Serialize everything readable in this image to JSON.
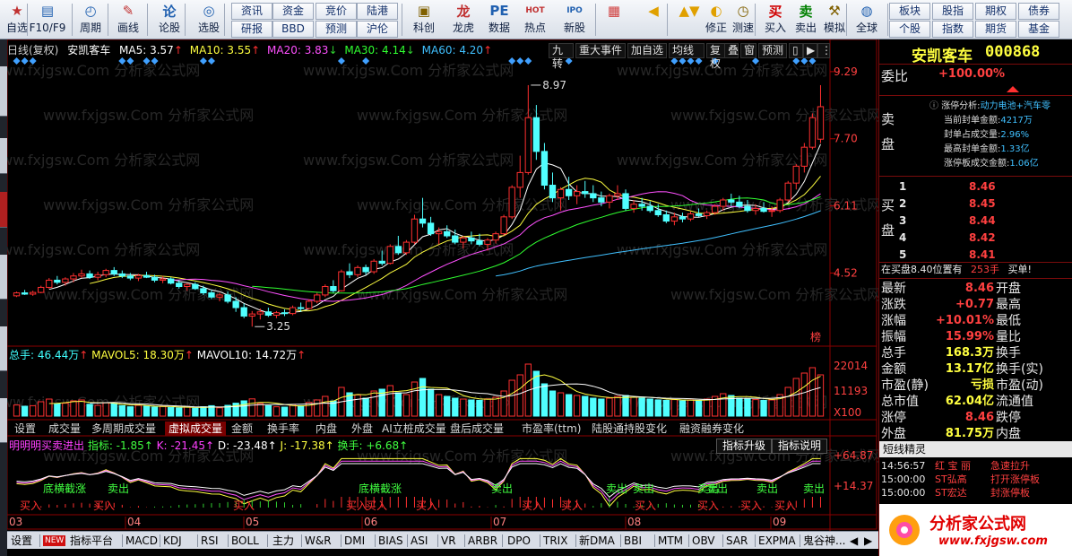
{
  "toolbar": {
    "items": [
      {
        "label": "自选",
        "icon": "star-icon",
        "ic": "★",
        "color": "#c03030"
      },
      {
        "label": "F10/F9",
        "icon": "file-icon",
        "ic": "▤",
        "color": "#2060b0"
      },
      {
        "label": "周期",
        "icon": "clock-icon",
        "ic": "◴",
        "color": "#2060b0"
      },
      {
        "label": "画线",
        "icon": "pen-icon",
        "ic": "✎",
        "color": "#c03030"
      },
      {
        "label": "论股",
        "icon": "forum-icon",
        "ic": "论",
        "color": "#2060b0"
      },
      {
        "label": "选股",
        "icon": "select-icon",
        "ic": "◎",
        "color": "#2060b0"
      },
      {
        "label": "科创",
        "icon": "kechuang-icon",
        "ic": "▣",
        "color": "#806000"
      },
      {
        "label": "龙虎",
        "icon": "dragon-icon",
        "ic": "龙",
        "color": "#c03030"
      },
      {
        "label": "数据",
        "icon": "data-icon",
        "ic": "PE",
        "color": "#2060b0"
      },
      {
        "label": "热点",
        "icon": "hot-icon",
        "ic": "HOT",
        "color": "#c03030"
      },
      {
        "label": "新股",
        "icon": "ipo-icon",
        "ic": "IPO",
        "color": "#2060b0"
      },
      {
        "label": "",
        "icon": "windows-icon",
        "ic": "▦",
        "color": "#d04040"
      },
      {
        "label": "",
        "icon": "back-arrow-icon",
        "ic": "◀",
        "color": "#e0a000"
      },
      {
        "label": "",
        "icon": "updown-arrow-icon",
        "ic": "▲▼",
        "color": "#e0a000"
      },
      {
        "label": "修正",
        "icon": "fix-icon",
        "ic": "◐",
        "color": "#e0a000"
      },
      {
        "label": "测速",
        "icon": "speed-icon",
        "ic": "◷",
        "color": "#806000"
      },
      {
        "label": "买入",
        "icon": "buy-icon",
        "ic": "买",
        "color": "#d00000"
      },
      {
        "label": "卖出",
        "icon": "sell-icon",
        "ic": "卖",
        "color": "#008000"
      },
      {
        "label": "模拟",
        "icon": "hammer-icon",
        "ic": "⚒",
        "color": "#806000"
      },
      {
        "label": "全球",
        "icon": "globe-icon",
        "ic": "◍",
        "color": "#2060b0"
      }
    ],
    "small": [
      "资讯",
      "资金",
      "竞价",
      "陆港",
      "研报",
      "BBD",
      "预测",
      "沪伦",
      "板块",
      "股指",
      "期权",
      "债券",
      "个股",
      "指数",
      "期货",
      "基金"
    ]
  },
  "header": {
    "period": "日线(复权)",
    "name": "安凯客车",
    "ma5": "MA5: 3.57",
    "ma10": "MA10: 3.55",
    "ma20": "MA20: 3.83",
    "ma30": "MA30: 4.14",
    "ma60": "MA60: 4.20"
  },
  "menu": [
    "九转",
    "重大事件",
    "加自选",
    "均线",
    "复权",
    "叠",
    "窗",
    "预测"
  ],
  "price_axis": [
    "9.29",
    "7.70",
    "6.11",
    "4.52"
  ],
  "annotations": {
    "high": "8.97",
    "low": "3.25",
    "bang": "榜"
  },
  "vol": {
    "title": "总手: 46.44万",
    "mavol5": "MAVOL5: 18.30万",
    "mavol10": "MAVOL10: 14.72万",
    "ticks": [
      "22014",
      "11193",
      "X100"
    ]
  },
  "vol_tabs": [
    "设置",
    "成交量",
    "多周期成交量",
    "虚拟成交量",
    "金额",
    "换手率",
    "内盘",
    "外盘",
    "AI立桩成交量",
    "盘后成交量",
    "市盈率(ttm)",
    "陆股通持股变化",
    "融资融券变化"
  ],
  "ind": {
    "name": "明明明买卖进出",
    "zb": "指标: -1.85",
    "k": "K: -21.45",
    "d": "D: -23.48",
    "j": "J: -17.38",
    "hs": "换手: +6.68",
    "btn1": "指标升级",
    "btn2": "指标说明",
    "ticks": [
      "+64.87",
      "+14.37"
    ],
    "sig_top": [
      "底横截涨",
      "卖出",
      "底横截涨",
      "卖出",
      "卖出",
      "卖出",
      "卖出",
      "卖出",
      "卖出",
      "卖出"
    ],
    "sig_bot": [
      "买入",
      "买入",
      "买入",
      "买入",
      "买入",
      "买入",
      "买入",
      "买入",
      "买入",
      "买入",
      "买入",
      "买入"
    ]
  },
  "months": [
    "03",
    "04",
    "05",
    "06",
    "07",
    "08",
    "09"
  ],
  "bottom": [
    "设置",
    "NEW",
    "指标平台",
    "MACD",
    "KDJ",
    "RSI",
    "BOLL",
    "主力",
    "W&R",
    "DMI",
    "BIAS",
    "ASI",
    "VR",
    "ARBR",
    "DPO",
    "TRIX",
    "新DMA",
    "BBI",
    "MTM",
    "OBV",
    "SAR",
    "EXPMA",
    "鬼谷神..."
  ],
  "stock": {
    "name": "安凯客车",
    "code": "000868"
  },
  "weibi": {
    "label": "委比",
    "value": "+100.00%"
  },
  "zt": {
    "l1": "涨停分析:",
    "l1v": "动力电池+汽车零",
    "l2": "当前封单金额:",
    "l2v": "4217万",
    "l3": "封单占成交量:",
    "l3v": "2.96%",
    "l4": "最高封单金额:",
    "l4v": "1.33亿",
    "l5": "涨停板成交金额:",
    "l5v": "1.06亿"
  },
  "sell_label": "卖盘",
  "buy_label": "买盘",
  "bids": [
    {
      "n": "1",
      "p": "8.46"
    },
    {
      "n": "2",
      "p": "8.45"
    },
    {
      "n": "3",
      "p": "8.44"
    },
    {
      "n": "4",
      "p": "8.42"
    },
    {
      "n": "5",
      "p": "8.41"
    }
  ],
  "bidline": {
    "t1": "在买盘8.40位置有",
    "v": "253手",
    "t2": "买单!"
  },
  "quotes": [
    {
      "l": "最新",
      "v": "8.46",
      "l2": "开盘",
      "v2": ""
    },
    {
      "l": "涨跌",
      "v": "+0.77",
      "l2": "最高",
      "v2": ""
    },
    {
      "l": "涨幅",
      "v": "+10.01%",
      "l2": "最低",
      "v2": ""
    },
    {
      "l": "振幅",
      "v": "15.99%",
      "l2": "量比",
      "v2": ""
    },
    {
      "l": "总手",
      "v": "168.3万",
      "l2": "换手",
      "v2": ""
    },
    {
      "l": "金额",
      "v": "13.17亿",
      "l2": "换手(实)",
      "v2": ""
    },
    {
      "l": "市盈(静)",
      "v": "亏损",
      "l2": "市盈(动)",
      "v2": ""
    },
    {
      "l": "总市值",
      "v": "62.04亿",
      "l2": "流通值",
      "v2": ""
    },
    {
      "l": "涨停",
      "v": "8.46",
      "l2": "跌停",
      "v2": ""
    },
    {
      "l": "外盘",
      "v": "81.75万",
      "l2": "内盘",
      "v2": ""
    }
  ],
  "short_title": "短线精灵",
  "news": [
    {
      "t": "14:56:57",
      "s": "红 宝 丽",
      "e": "急速拉升"
    },
    {
      "t": "15:00:00",
      "s": "ST弘高",
      "e": "打开涨停板"
    },
    {
      "t": "15:00:00",
      "s": "ST宏达",
      "e": "封涨停板"
    }
  ],
  "watermark": {
    "line": "www.fxjgsw.Com 分析家公式网",
    "logo": "分析家公式网",
    "url": "www.fxjgsw.com"
  },
  "chart_data": {
    "type": "candlestick",
    "series": [
      {
        "name": "K线",
        "ohlc": [
          [
            3.98,
            4.08,
            3.95,
            4.05
          ],
          [
            4.05,
            4.12,
            4.0,
            4.02
          ],
          [
            4.02,
            4.1,
            3.98,
            4.06
          ],
          [
            4.06,
            4.22,
            4.04,
            4.18
          ],
          [
            4.18,
            4.4,
            4.15,
            4.35
          ],
          [
            4.35,
            4.45,
            4.25,
            4.3
          ],
          [
            4.3,
            4.42,
            4.22,
            4.38
          ],
          [
            4.38,
            4.52,
            4.3,
            4.45
          ],
          [
            4.45,
            4.6,
            4.4,
            4.5
          ],
          [
            4.5,
            4.58,
            4.38,
            4.42
          ],
          [
            4.42,
            4.55,
            4.35,
            4.48
          ],
          [
            4.48,
            4.62,
            4.42,
            4.58
          ],
          [
            4.58,
            4.66,
            4.45,
            4.5
          ],
          [
            4.5,
            4.58,
            4.4,
            4.45
          ],
          [
            4.45,
            4.52,
            4.35,
            4.4
          ],
          [
            4.4,
            4.5,
            4.33,
            4.46
          ],
          [
            4.46,
            4.55,
            4.4,
            4.42
          ],
          [
            4.42,
            4.48,
            4.3,
            4.35
          ],
          [
            4.35,
            4.45,
            4.28,
            4.38
          ],
          [
            4.38,
            4.42,
            4.25,
            4.28
          ],
          [
            4.28,
            4.35,
            4.15,
            4.2
          ],
          [
            4.2,
            4.28,
            4.1,
            4.25
          ],
          [
            4.25,
            4.3,
            4.12,
            4.15
          ],
          [
            4.15,
            4.22,
            4.0,
            4.05
          ],
          [
            4.05,
            4.12,
            3.9,
            3.95
          ],
          [
            3.95,
            4.05,
            3.85,
            4.0
          ],
          [
            4.0,
            4.08,
            3.8,
            3.85
          ],
          [
            3.85,
            3.95,
            3.6,
            3.7
          ],
          [
            3.7,
            3.8,
            3.45,
            3.5
          ],
          [
            3.5,
            3.62,
            3.25,
            3.55
          ],
          [
            3.55,
            3.68,
            3.42,
            3.6
          ],
          [
            3.6,
            3.7,
            3.48,
            3.52
          ],
          [
            3.52,
            3.62,
            3.45,
            3.58
          ],
          [
            3.58,
            3.66,
            3.5,
            3.56
          ],
          [
            3.56,
            3.75,
            3.52,
            3.7
          ],
          [
            3.7,
            3.82,
            3.6,
            3.68
          ],
          [
            3.68,
            3.9,
            3.65,
            3.85
          ],
          [
            3.85,
            4.05,
            3.8,
            4.0
          ],
          [
            4.0,
            4.25,
            3.95,
            4.2
          ],
          [
            4.2,
            4.35,
            4.05,
            4.1
          ],
          [
            4.1,
            4.6,
            4.08,
            4.55
          ],
          [
            4.55,
            4.75,
            4.4,
            4.48
          ],
          [
            4.48,
            4.7,
            4.42,
            4.65
          ],
          [
            4.65,
            4.72,
            4.48,
            4.55
          ],
          [
            4.55,
            4.85,
            4.5,
            4.8
          ],
          [
            4.8,
            5.05,
            4.7,
            4.75
          ],
          [
            4.75,
            5.2,
            4.72,
            5.15
          ],
          [
            5.15,
            5.4,
            4.95,
            5.0
          ],
          [
            5.0,
            5.3,
            4.95,
            5.25
          ],
          [
            5.25,
            5.9,
            5.2,
            5.8
          ],
          [
            5.8,
            6.3,
            5.6,
            5.7
          ],
          [
            5.7,
            5.85,
            5.4,
            5.45
          ],
          [
            5.45,
            5.6,
            5.2,
            5.5
          ],
          [
            5.5,
            5.65,
            5.35,
            5.4
          ],
          [
            5.4,
            5.55,
            5.2,
            5.25
          ],
          [
            5.25,
            5.4,
            5.1,
            5.35
          ],
          [
            5.35,
            5.5,
            5.2,
            5.28
          ],
          [
            5.28,
            5.45,
            5.15,
            5.2
          ],
          [
            5.2,
            5.35,
            5.05,
            5.3
          ],
          [
            5.3,
            5.5,
            5.22,
            5.45
          ],
          [
            5.45,
            5.9,
            5.4,
            5.85
          ],
          [
            5.85,
            6.6,
            5.8,
            6.55
          ],
          [
            6.55,
            7.3,
            6.3,
            6.9
          ],
          [
            6.9,
            8.97,
            6.85,
            8.2
          ],
          [
            8.2,
            8.5,
            7.2,
            7.4
          ],
          [
            7.4,
            7.6,
            6.5,
            6.6
          ],
          [
            6.6,
            6.9,
            6.2,
            6.3
          ],
          [
            6.3,
            6.55,
            6.0,
            6.5
          ],
          [
            6.5,
            6.8,
            6.25,
            6.35
          ],
          [
            6.35,
            6.6,
            6.15,
            6.45
          ],
          [
            6.45,
            6.7,
            6.3,
            6.4
          ],
          [
            6.4,
            6.6,
            6.2,
            6.3
          ],
          [
            6.3,
            6.45,
            6.1,
            6.2
          ],
          [
            6.2,
            6.4,
            6.05,
            6.35
          ],
          [
            6.35,
            6.6,
            6.25,
            6.4
          ],
          [
            6.4,
            6.5,
            6.0,
            6.05
          ],
          [
            6.05,
            6.25,
            5.95,
            6.15
          ],
          [
            6.15,
            6.3,
            6.0,
            6.1
          ],
          [
            6.1,
            6.22,
            5.95,
            6.0
          ],
          [
            6.0,
            6.15,
            5.85,
            5.9
          ],
          [
            5.9,
            6.0,
            5.7,
            5.75
          ],
          [
            5.75,
            5.95,
            5.65,
            5.85
          ],
          [
            5.85,
            5.95,
            5.72,
            5.8
          ],
          [
            5.8,
            5.98,
            5.75,
            5.92
          ],
          [
            5.92,
            6.05,
            5.85,
            5.88
          ],
          [
            5.88,
            6.0,
            5.8,
            5.95
          ],
          [
            5.95,
            6.15,
            5.9,
            6.1
          ],
          [
            6.1,
            6.3,
            6.0,
            6.25
          ],
          [
            6.25,
            6.4,
            6.1,
            6.2
          ],
          [
            6.2,
            6.35,
            6.05,
            6.1
          ],
          [
            6.1,
            6.25,
            5.95,
            6.0
          ],
          [
            6.0,
            6.15,
            5.9,
            6.05
          ],
          [
            6.05,
            6.2,
            5.95,
            5.98
          ],
          [
            5.98,
            6.1,
            5.85,
            6.0
          ],
          [
            6.0,
            6.3,
            5.95,
            6.25
          ],
          [
            6.25,
            6.7,
            6.2,
            6.65
          ],
          [
            6.65,
            7.1,
            6.5,
            7.05
          ],
          [
            7.05,
            7.6,
            6.9,
            7.5
          ],
          [
            7.5,
            8.3,
            7.45,
            8.2
          ],
          [
            7.69,
            8.97,
            7.6,
            8.46
          ]
        ]
      }
    ],
    "volume": [
      62,
      55,
      58,
      80,
      95,
      70,
      72,
      85,
      90,
      66,
      60,
      74,
      70,
      58,
      52,
      60,
      55,
      50,
      54,
      48,
      46,
      50,
      44,
      52,
      58,
      46,
      60,
      72,
      85,
      96,
      70,
      58,
      52,
      50,
      64,
      58,
      76,
      90,
      110,
      84,
      160,
      130,
      118,
      100,
      140,
      150,
      170,
      130,
      120,
      190,
      210,
      150,
      120,
      110,
      100,
      95,
      90,
      88,
      96,
      105,
      140,
      200,
      230,
      290,
      250,
      180,
      140,
      130,
      120,
      115,
      110,
      100,
      95,
      100,
      110,
      115,
      105,
      100,
      95,
      90,
      88,
      92,
      85,
      90,
      86,
      95,
      110,
      125,
      115,
      100,
      95,
      92,
      88,
      90,
      120,
      160,
      210,
      240,
      270,
      230
    ],
    "ylim": [
      3.0,
      9.5
    ]
  }
}
